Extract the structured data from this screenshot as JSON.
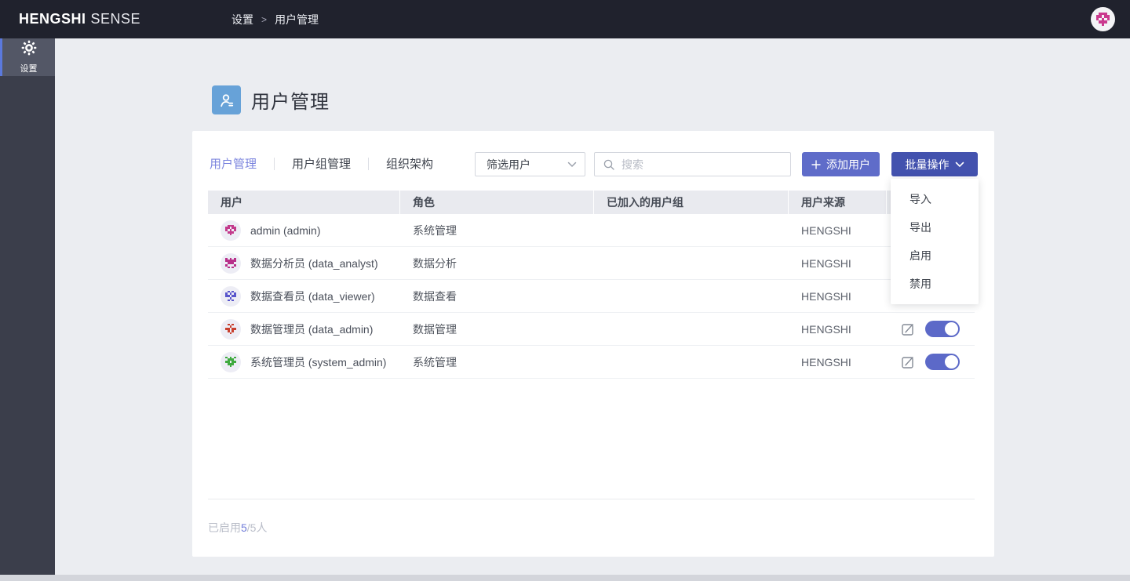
{
  "topbar": {
    "brand": {
      "bold": "HENGSHI",
      "light": "SENSE"
    },
    "breadcrumb": {
      "items": [
        "设置",
        "用户管理"
      ],
      "separator": ">"
    }
  },
  "sidebar": {
    "items": [
      {
        "label": "设置",
        "icon": "gear-icon",
        "active": true
      }
    ]
  },
  "page": {
    "title": "用户管理"
  },
  "tabs": [
    {
      "label": "用户管理",
      "active": true
    },
    {
      "label": "用户组管理",
      "active": false
    },
    {
      "label": "组织架构",
      "active": false
    }
  ],
  "controls": {
    "filter": {
      "value": "筛选用户"
    },
    "search": {
      "placeholder": "搜索"
    },
    "add_user_button": {
      "label": "添加用户"
    },
    "batch_button": {
      "label": "批量操作"
    }
  },
  "batch_menu": {
    "items": [
      "导入",
      "导出",
      "启用",
      "禁用"
    ]
  },
  "table": {
    "headers": [
      "用户",
      "角色",
      "已加入的用户组",
      "用户来源",
      ""
    ],
    "rows": [
      {
        "name": "admin (admin)",
        "role": "系统管理",
        "groups": "",
        "source": "HENGSHI",
        "enabled": true,
        "avatar": {
          "color": "#c33a8c",
          "pattern": [
            "01110",
            "11011",
            "10101",
            "01110",
            "00100"
          ]
        }
      },
      {
        "name": "数据分析员 (data_analyst)",
        "role": "数据分析",
        "groups": "",
        "source": "HENGSHI",
        "enabled": true,
        "avatar": {
          "color": "#b8308a",
          "pattern": [
            "10101",
            "11111",
            "01110",
            "10001",
            "01010"
          ]
        }
      },
      {
        "name": "数据查看员 (data_viewer)",
        "role": "数据查看",
        "groups": "",
        "source": "HENGSHI",
        "enabled": true,
        "avatar": {
          "color": "#5956cc",
          "pattern": [
            "01010",
            "10101",
            "11011",
            "00100",
            "01010"
          ]
        }
      },
      {
        "name": "数据管理员 (data_admin)",
        "role": "数据管理",
        "groups": "",
        "source": "HENGSHI",
        "enabled": true,
        "avatar": {
          "color": "#c8402e",
          "pattern": [
            "01010",
            "00100",
            "11011",
            "01010",
            "00100"
          ]
        }
      },
      {
        "name": "系统管理员 (system_admin)",
        "role": "系统管理",
        "groups": "",
        "source": "HENGSHI",
        "enabled": true,
        "avatar": {
          "color": "#3faa3f",
          "pattern": [
            "10101",
            "01110",
            "11011",
            "01110",
            "00100"
          ]
        }
      }
    ]
  },
  "footer": {
    "prefix": "已启用",
    "enabled_count": "5",
    "suffix": "/5人"
  },
  "user_avatar": {
    "color": "#cb3a8e",
    "pattern": [
      "01110",
      "11011",
      "10101",
      "01110",
      "00100"
    ]
  },
  "colors": {
    "topbar_bg": "#20222d",
    "sidebar_bg": "#3b3e4b",
    "sidebar_active_border": "#5b79dd",
    "accent_tab": "#7b84de",
    "add_button": "#5f6cc9",
    "batch_button": "#4352ae",
    "toggle_on": "#5c69c8",
    "title_icon_bg": "#67a2d8",
    "header_row_bg": "#e9eaef",
    "page_bg": "#ebedf1"
  }
}
